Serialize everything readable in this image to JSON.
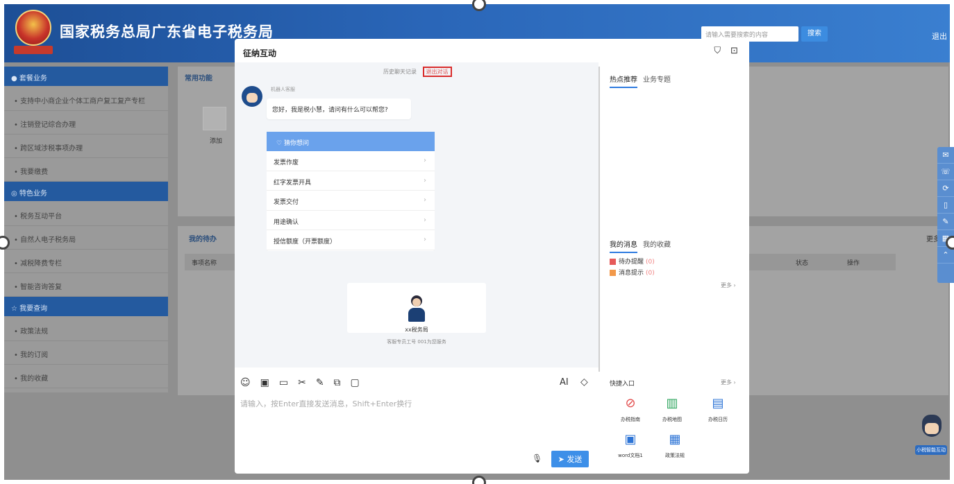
{
  "site": {
    "title": "国家税务总局广东省电子税务局",
    "search_placeholder": "请输入需要搜索的内容",
    "search_button": "搜索",
    "logout": "退出"
  },
  "sidebar": {
    "sections": [
      {
        "label": "套餐业务",
        "items": [
          "支持中小商企业个体工商户复工复产专栏",
          "注销登记综合办理",
          "跨区域涉税事项办理",
          "我要缴费"
        ]
      },
      {
        "label": "特色业务",
        "items": [
          "税务互动平台",
          "自然人电子税务局",
          "减税降费专栏",
          "智能咨询答复"
        ]
      },
      {
        "label": "我要查询",
        "items": [
          "政策法规",
          "我的订阅",
          "我的收藏"
        ]
      }
    ]
  },
  "panel_common": {
    "tab": "常用功能",
    "add_label": "添加"
  },
  "panel_todo": {
    "title": "我的待办",
    "header_cols": [
      "事项名称",
      "状态",
      "操作"
    ],
    "more": "更多"
  },
  "fab_label": "小税智能互动",
  "modal": {
    "title": "征纳互动",
    "history_link": "历史聊天记录",
    "clear_link": "退出对话",
    "bot_name": "机器人客服",
    "greeting": "您好，我是税小慧，请问有什么可以帮您?",
    "faq_title": "猜你想问",
    "faq_items": [
      "发票作废",
      "红字发票开具",
      "发票交付",
      "用途确认",
      "授信额度（开票额度）"
    ],
    "agent_name": "xx税务局",
    "agent_desc": "客服专员工号 001为您服务",
    "ai_label": "AI",
    "input_placeholder": "请输入，按Enter直接发送消息，Shift+Enter换行",
    "send_label": "➤ 发送"
  },
  "right": {
    "tabs": [
      "热点推荐",
      "业务专题"
    ],
    "msg_tabs": [
      "我的消息",
      "我的收藏"
    ],
    "messages": [
      {
        "label": "待办提醒",
        "count": "(0)",
        "color": "#e65a5a"
      },
      {
        "label": "消息提示",
        "count": "(0)",
        "color": "#f2994a"
      }
    ],
    "more": "更多 ›",
    "quick_title": "快捷入口",
    "quick_more": "更多 ›",
    "quick_items": [
      {
        "label": "办税指南",
        "icon": "compass-icon",
        "color": "#e24a4a"
      },
      {
        "label": "办税地图",
        "icon": "map-icon",
        "color": "#29a35a"
      },
      {
        "label": "办税日历",
        "icon": "calendar-icon",
        "color": "#2d74d6"
      },
      {
        "label": "word文档1",
        "icon": "document-icon",
        "color": "#2d74d6"
      },
      {
        "label": "政策法规",
        "icon": "policy-icon",
        "color": "#2d74d6"
      }
    ]
  }
}
